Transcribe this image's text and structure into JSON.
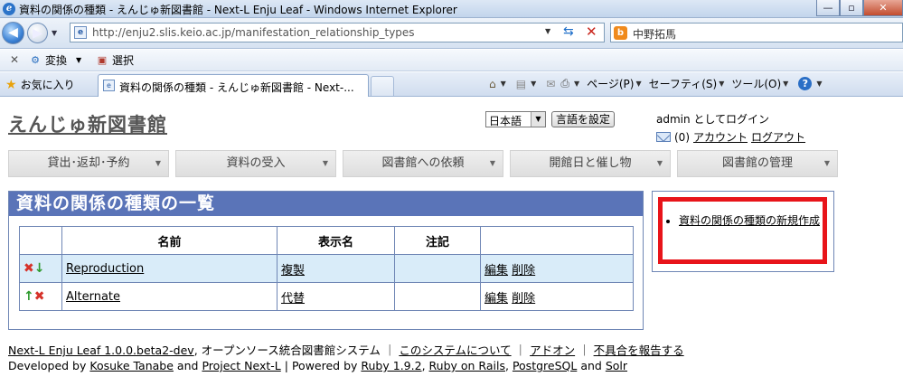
{
  "window": {
    "title": "資料の関係の種類 - えんじゅ新図書館 - Next-L Enju Leaf - Windows Internet Explorer",
    "min": "—",
    "max": "▫",
    "close": "✕"
  },
  "browser": {
    "url": "http://enju2.slis.keio.ac.jp/manifestation_relationship_types",
    "search_text": "中野拓馬",
    "toolbar": {
      "convert": "変換",
      "select": "選択"
    },
    "favorites": "お気に入り",
    "tab_title": "資料の関係の種類 - えんじゅ新図書館 - Next-...",
    "commands": {
      "page": "ページ(P)",
      "safety": "セーフティ(S)",
      "tools": "ツール(O)"
    }
  },
  "site": {
    "title": "えんじゅ新図書館",
    "language_value": "日本語",
    "language_button": "言語を設定",
    "login_text": "admin としてログイン",
    "message_count": "(0)",
    "account_link": "アカウント",
    "logout_link": "ログアウト"
  },
  "menu": [
    {
      "label": "貸出･返却･予約"
    },
    {
      "label": "資料の受入"
    },
    {
      "label": "図書館への依頼"
    },
    {
      "label": "開館日と催し物"
    },
    {
      "label": "図書館の管理"
    }
  ],
  "panel": {
    "heading": "資料の関係の種類の一覧",
    "columns": {
      "name": "名前",
      "display_name": "表示名",
      "note": "注記"
    },
    "rows": [
      {
        "name": "Reproduction",
        "display_name": "複製",
        "note": "",
        "edit": "編集",
        "delete": "削除"
      },
      {
        "name": "Alternate",
        "display_name": "代替",
        "note": "",
        "edit": "編集",
        "delete": "削除"
      }
    ]
  },
  "sidebar": {
    "new_link": "資料の関係の種類の新規作成"
  },
  "footer": {
    "line1": {
      "app": "Next-L Enju Leaf 1.0.0.beta2-dev",
      "desc": ", オープンソース統合図書館システム ｜",
      "about": "このシステムについて",
      "sep1": "｜",
      "addon": "アドオン",
      "sep2": "｜",
      "report": "不具合を報告する"
    },
    "line2": {
      "developed_by": "Developed by",
      "author": "Kosuke Tanabe",
      "and1": "and",
      "project": "Project Next-L",
      "powered": "| Powered by",
      "ruby": "Ruby 1.9.2",
      "comma1": ",",
      "rails": "Ruby on Rails",
      "comma2": ",",
      "pg": "PostgreSQL",
      "and2": "and",
      "solr": "Solr"
    }
  },
  "colors": {
    "panel_header": "#5a74b8",
    "row_highlight": "#d9ecf9",
    "annotation_red": "#e8141a"
  }
}
